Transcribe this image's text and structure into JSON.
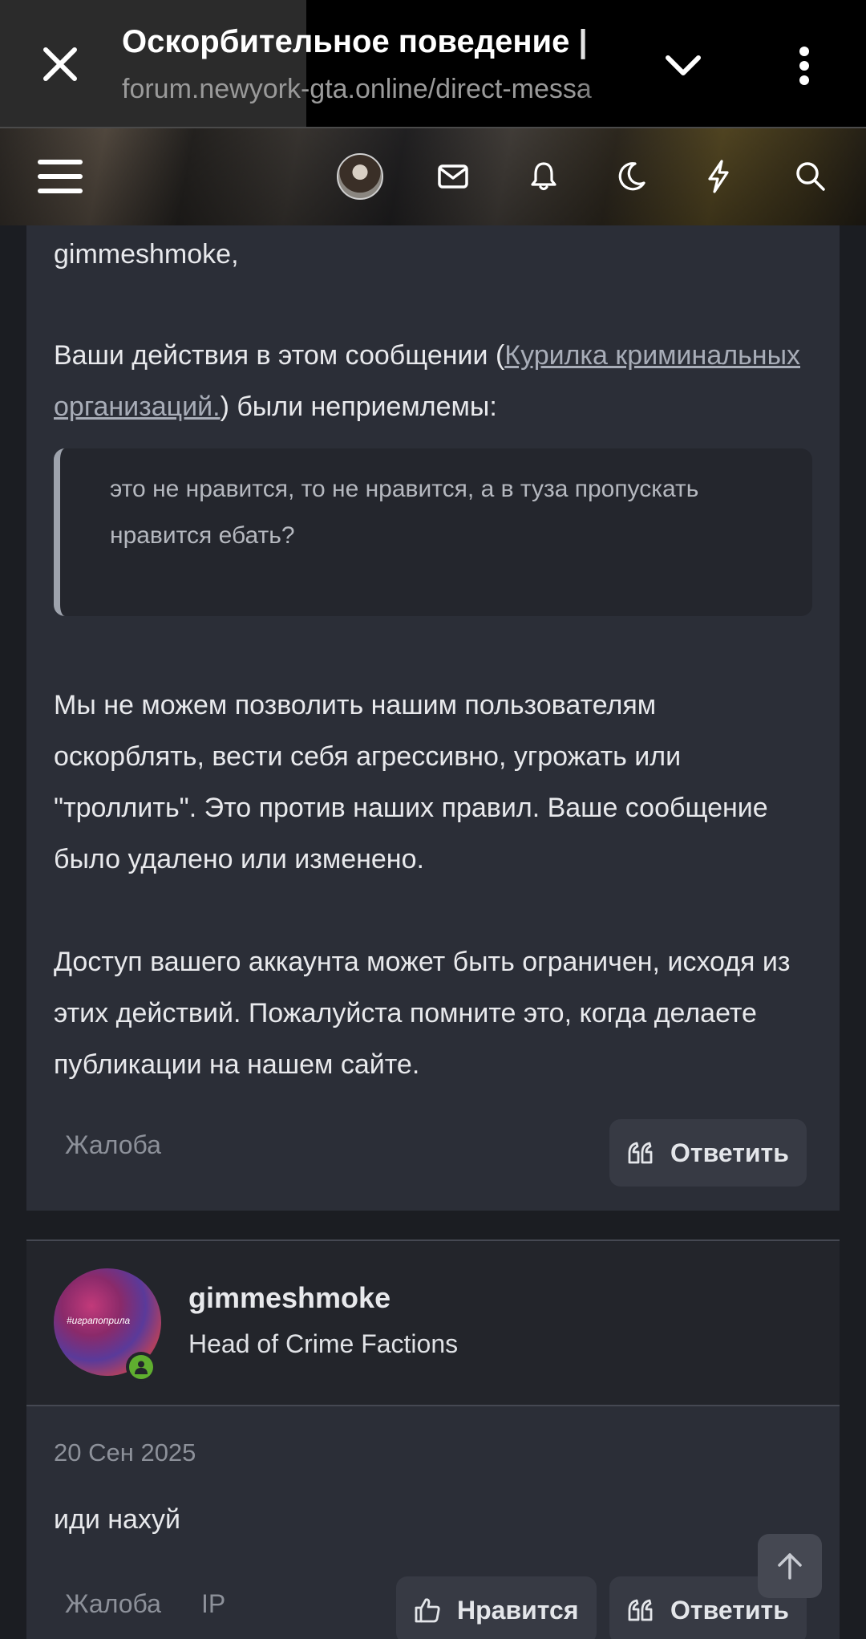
{
  "browser": {
    "title": "Оскорбительное поведение |",
    "url": "forum.newyork-gta.online/direct-messa"
  },
  "header": {
    "icons": [
      "menu-icon",
      "avatar",
      "mail-icon",
      "bell-icon",
      "moon-icon",
      "lightning-icon",
      "search-icon"
    ]
  },
  "message": {
    "greeting": "gimmeshmoke,",
    "intro_prefix": "Ваши действия в этом сообщении (",
    "intro_link": "Курилка криминальных организаций.",
    "intro_suffix": ") были неприемлемы:",
    "quote": "это не нравится, то не нравится, а в туза пропускать нравится ебать?",
    "paragraph1": "Мы не можем позволить нашим пользователям оскорблять, вести себя агрессивно, угрожать или \"троллить\". Это против наших правил. Ваше сообщение было удалено или изменено.",
    "paragraph2": "Доступ вашего аккаунта может быть ограничен, исходя из этих действий. Пожалуйста помните это, когда делаете публикации на нашем сайте.",
    "report_label": "Жалоба",
    "reply_label": "Ответить"
  },
  "author": {
    "name": "gimmeshmoke",
    "title": "Head of Crime Factions",
    "avatar_caption": "#играпоприла"
  },
  "reply": {
    "date": "20 Сен 2025",
    "text": "иди нахуй",
    "report_label": "Жалоба",
    "ip_label": "IP",
    "like_label": "Нравится",
    "reply_label": "Ответить"
  },
  "colors": {
    "card_bg": "#2b2e37",
    "page_bg": "#1b1d22",
    "online": "#5fae2f"
  }
}
